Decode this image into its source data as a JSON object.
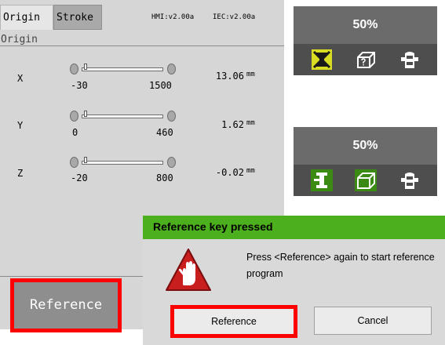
{
  "tabs": [
    {
      "label": "Origin",
      "active": true
    },
    {
      "label": "Stroke",
      "active": false
    }
  ],
  "versions": {
    "hmi": "HMI:v2.00a",
    "iec": "IEC:v2.00a"
  },
  "section_title": "Origin",
  "axes": [
    {
      "name": "X",
      "min": "-30",
      "max": "1500",
      "position": "13.06",
      "unit": "mm"
    },
    {
      "name": "Y",
      "min": "0",
      "max": "460",
      "position": "1.62",
      "unit": "mm"
    },
    {
      "name": "Z",
      "min": "-20",
      "max": "800",
      "position": "-0.02",
      "unit": "mm"
    }
  ],
  "reference_button_label": "Reference",
  "status_panels": [
    {
      "percent": "50%",
      "icons": [
        "axis-warning-icon",
        "workpiece-unknown-icon",
        "clamp-icon"
      ]
    },
    {
      "percent": "50%",
      "icons": [
        "axis-icon",
        "workpiece-icon",
        "clamp-icon"
      ]
    }
  ],
  "dialog": {
    "title": "Reference key pressed",
    "message": "Press <Reference> again to start reference program",
    "reference_label": "Reference",
    "cancel_label": "Cancel"
  },
  "colors": {
    "dialog_header": "#4caf1e",
    "highlight": "#ff0000",
    "status_bg": "#6b6b6b",
    "icon_active": "#3a8a14",
    "icon_warning": "#d8dc22"
  }
}
